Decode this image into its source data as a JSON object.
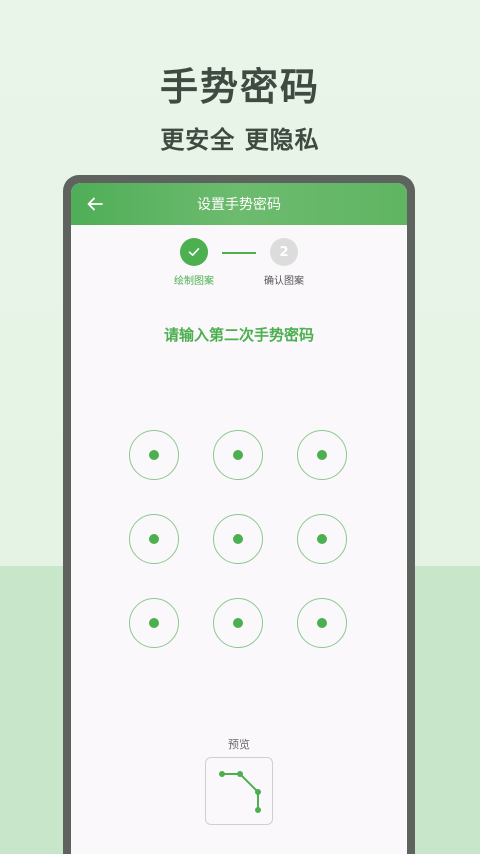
{
  "promo": {
    "title": "手势密码",
    "subtitle": "更安全 更隐私"
  },
  "app_bar": {
    "back_icon": "arrow-left-icon",
    "title": "设置手势密码"
  },
  "stepper": {
    "steps": [
      {
        "label": "绘制图案",
        "state": "done",
        "icon": "check-icon"
      },
      {
        "label": "确认图案",
        "state": "pending",
        "number": "2"
      }
    ]
  },
  "instruction": "请输入第二次手势密码",
  "preview": {
    "label": "预览",
    "path_nodes": [
      1,
      2,
      6,
      9
    ]
  },
  "colors": {
    "accent": "#4caf50",
    "node_ring": "#8cc98f",
    "pending_step": "#dcdcdc",
    "app_bar": "#5fb562"
  }
}
